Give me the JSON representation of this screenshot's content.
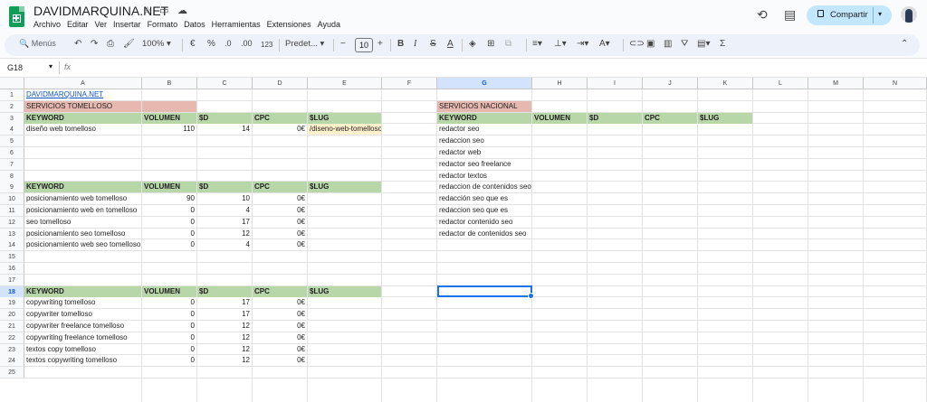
{
  "doc": {
    "title": "DAVIDMARQUINA.NET"
  },
  "menu": [
    "Archivo",
    "Editar",
    "Ver",
    "Insertar",
    "Formato",
    "Datos",
    "Herramientas",
    "Extensiones",
    "Ayuda"
  ],
  "share": {
    "label": "Compartir"
  },
  "toolbar": {
    "search": "Menús",
    "zoom": "100%",
    "currency": "€",
    "percent": "%",
    "dec_less": ".0",
    "dec_more": ".00",
    "num_format": "123",
    "font": "Predet...",
    "font_size": "10"
  },
  "formula_bar": {
    "cell_ref": "G18",
    "fx": "fx"
  },
  "columns": [
    "A",
    "B",
    "C",
    "D",
    "E",
    "F",
    "G",
    "H",
    "I",
    "J",
    "K",
    "L",
    "M",
    "N"
  ],
  "rows": [
    "1",
    "2",
    "3",
    "4",
    "5",
    "6",
    "7",
    "8",
    "9",
    "10",
    "11",
    "12",
    "13",
    "14",
    "15",
    "16",
    "17",
    "18",
    "19",
    "20",
    "21",
    "22",
    "23",
    "24",
    "25"
  ],
  "cells": {
    "a1": "DAVIDMARQUINA.NET",
    "a2": "SERVICIOS TOMELLOSO",
    "hdr_keyword": "KEYWORD",
    "hdr_volumen": "VOLUMEN",
    "hdr_sd": "$D",
    "hdr_cpc": "CPC",
    "hdr_slug": "$LUG",
    "t1": [
      {
        "kw": "diseño web tomelloso",
        "vol": "110",
        "sd": "14",
        "cpc": "0€",
        "slug": "/diseno-web-tomelloso/"
      }
    ],
    "t2": [
      {
        "kw": "posicionamiento web tomelloso",
        "vol": "90",
        "sd": "10",
        "cpc": "0€"
      },
      {
        "kw": "posicionamiento web en tomelloso",
        "vol": "0",
        "sd": "4",
        "cpc": "0€"
      },
      {
        "kw": "seo tomelloso",
        "vol": "0",
        "sd": "17",
        "cpc": "0€"
      },
      {
        "kw": "posicionamiento seo tomelloso",
        "vol": "0",
        "sd": "12",
        "cpc": "0€"
      },
      {
        "kw": "posicionamiento web seo tomelloso",
        "vol": "0",
        "sd": "4",
        "cpc": "0€"
      }
    ],
    "t3": [
      {
        "kw": "copywriting tomelloso",
        "vol": "0",
        "sd": "17",
        "cpc": "0€"
      },
      {
        "kw": "copywriter tomelloso",
        "vol": "0",
        "sd": "17",
        "cpc": "0€"
      },
      {
        "kw": "copywriter freelance tomelloso",
        "vol": "0",
        "sd": "12",
        "cpc": "0€"
      },
      {
        "kw": "copywriting freelance tomelloso",
        "vol": "0",
        "sd": "12",
        "cpc": "0€"
      },
      {
        "kw": "textos copy tomelloso",
        "vol": "0",
        "sd": "12",
        "cpc": "0€"
      },
      {
        "kw": "textos copywriting tomelloso",
        "vol": "0",
        "sd": "12",
        "cpc": "0€"
      }
    ],
    "g2": "SERVICIOS NACIONAL",
    "nacional": [
      "redactor seo",
      "redaccion seo",
      "redactor web",
      "redactor seo freelance",
      "redactor textos",
      "redaccion de contenidos seo",
      "redacción seo que es",
      "redaccion seo que es",
      "redactor contenido seo",
      "redactor de contenidos seo"
    ]
  },
  "colors": {
    "header_green": "#b7d7a8",
    "title_red": "#e6b8af",
    "slug_yellow": "#fff2cc",
    "selection": "#1a73e8",
    "share_bg": "#c2e7ff"
  }
}
